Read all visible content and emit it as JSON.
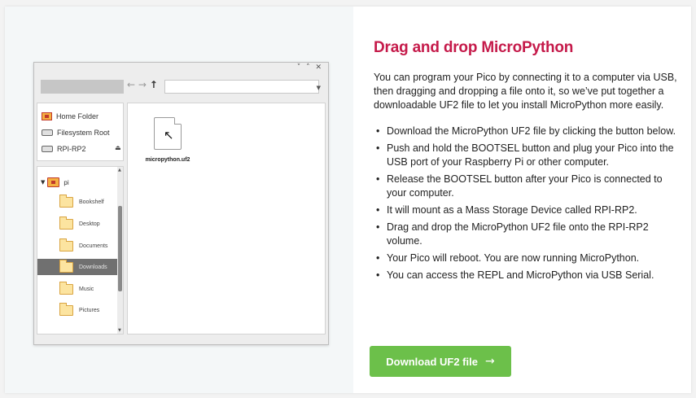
{
  "file_manager": {
    "window_controls": "˅ ˄ ✕",
    "nav_back": "←",
    "nav_forward": "→",
    "nav_up": "↑",
    "address_dropdown": "▼",
    "places": [
      {
        "label": "Home Folder",
        "icon": "home-folder-icon"
      },
      {
        "label": "Filesystem Root",
        "icon": "drive-icon"
      },
      {
        "label": "RPI-RP2",
        "icon": "drive-icon",
        "eject": "⏏"
      }
    ],
    "tree": {
      "expand_glyph": "▼",
      "root_label": "pi",
      "items": [
        {
          "label": "Bookshelf"
        },
        {
          "label": "Desktop"
        },
        {
          "label": "Documents"
        },
        {
          "label": "Downloads",
          "selected": true
        },
        {
          "label": "Music"
        },
        {
          "label": "Pictures"
        }
      ]
    },
    "scroll_up": "▲",
    "scroll_down": "▼",
    "file": {
      "name": "micropython.uf2",
      "cursor": "↖"
    }
  },
  "content": {
    "title": "Drag and drop MicroPython",
    "intro": "You can program your Pico by connecting it to a computer via USB, then dragging and dropping a file onto it, so we’ve put together a downloadable UF2 file to let you install MicroPython more easily.",
    "steps": [
      "Download the MicroPython UF2 file by clicking the button below.",
      "Push and hold the BOOTSEL button and plug your Pico into the USB port of your Raspberry Pi or other computer.",
      "Release the BOOTSEL button after your Pico is connected to your computer.",
      "It will mount as a Mass Storage Device called RPI-RP2.",
      "Drag and drop the MicroPython UF2 file onto the RPI-RP2 volume.",
      "Your Pico will reboot. You are now running MicroPython.",
      "You can access the REPL and MicroPython via USB Serial."
    ],
    "download_button": {
      "label": "Download UF2 file",
      "arrow": "→"
    }
  },
  "colors": {
    "title": "#c51a4a",
    "button": "#6cc04a",
    "selected_row": "#707070",
    "folder": "#fce4a0"
  }
}
